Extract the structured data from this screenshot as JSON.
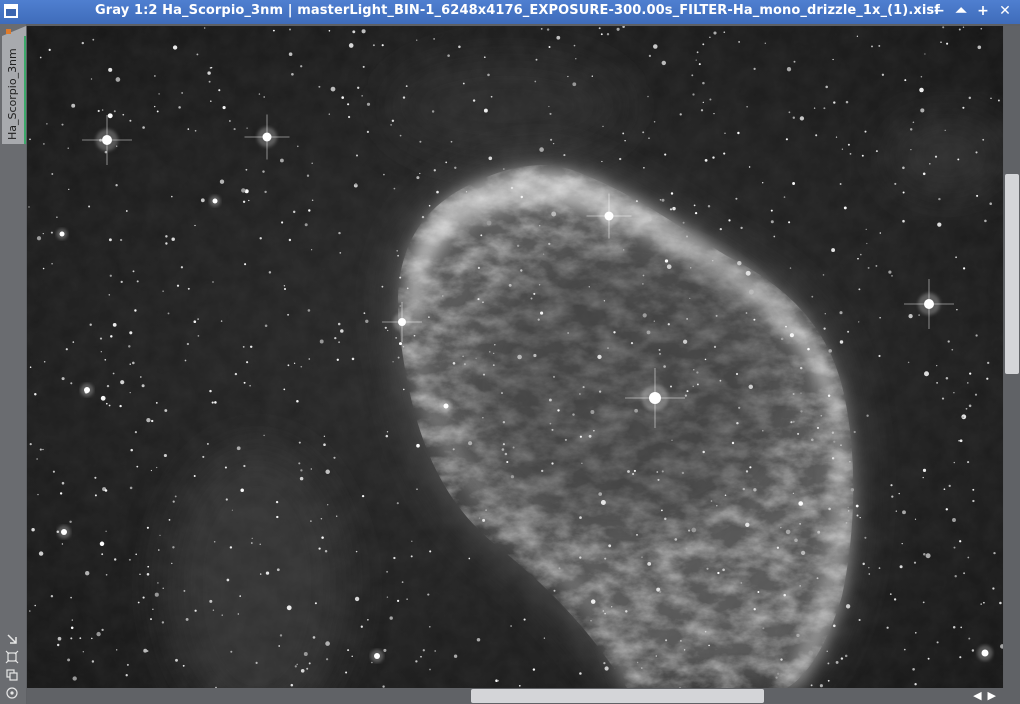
{
  "window": {
    "title": "Gray 1:2 Ha_Scorpio_3nm | masterLight_BIN-1_6248x4176_EXPOSURE-300.00s_FILTER-Ha_mono_drizzle_1x_(1).xisf",
    "controls": {
      "minimize": "−",
      "shade": "⏶",
      "maximize": "+",
      "close": "✕"
    }
  },
  "view_tab": {
    "label": "Ha_Scorpio_3nm"
  },
  "image": {
    "description_icon": "astro-image",
    "subject_icon": "nebula"
  },
  "colors": {
    "titlebar": "#4f7fd0",
    "tab_accent": "#3ca86a",
    "marker": "#e07b2a"
  }
}
